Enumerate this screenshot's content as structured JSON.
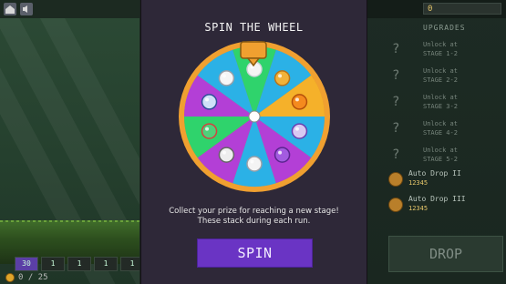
{
  "modal": {
    "title": "SPIN THE WHEEL",
    "description_line1": "Collect your prize for reaching a new stage!",
    "description_line2": "These stack during each run.",
    "spin_label": "SPIN",
    "wheel": {
      "segments": [
        {
          "color": "#2fd36c",
          "prize": "pearl-orbs-icon"
        },
        {
          "color": "#2bb1e6",
          "prize": "gold-coin-icon"
        },
        {
          "color": "#f5b12a",
          "prize": "orange-orb-icon"
        },
        {
          "color": "#2bb1e6",
          "prize": "purple-potion-icon"
        },
        {
          "color": "#b33fd6",
          "prize": "purple-gem-icon"
        },
        {
          "color": "#2bb1e6",
          "prize": "white-pearls-icon"
        },
        {
          "color": "#b33fd6",
          "prize": "clock-icon"
        },
        {
          "color": "#2fd36c",
          "prize": "colored-orbs-icon"
        },
        {
          "color": "#b33fd6",
          "prize": "blue-egg-icon"
        },
        {
          "color": "#2bb1e6",
          "prize": "white-orb-icon"
        }
      ],
      "rim_color": "#f0a030"
    }
  },
  "left_panel": {
    "footer_text": "0 / 25",
    "slots": [
      "30",
      "1",
      "1",
      "1",
      "1"
    ]
  },
  "right_panel": {
    "gold": "0",
    "upgrades_title": "UPGRADES",
    "upgrades": [
      {
        "line1": "Unlock at",
        "line2": "STAGE 1-2"
      },
      {
        "line1": "Unlock at",
        "line2": "STAGE 2-2"
      },
      {
        "line1": "Unlock at",
        "line2": "STAGE 3-2"
      },
      {
        "line1": "Unlock at",
        "line2": "STAGE 4-2"
      },
      {
        "line1": "Unlock at",
        "line2": "STAGE 5-2"
      }
    ],
    "drops": [
      {
        "name": "Auto Drop II",
        "cost": "12345"
      },
      {
        "name": "Auto Drop III",
        "cost": "12345"
      }
    ],
    "drop_label": "DROP"
  }
}
